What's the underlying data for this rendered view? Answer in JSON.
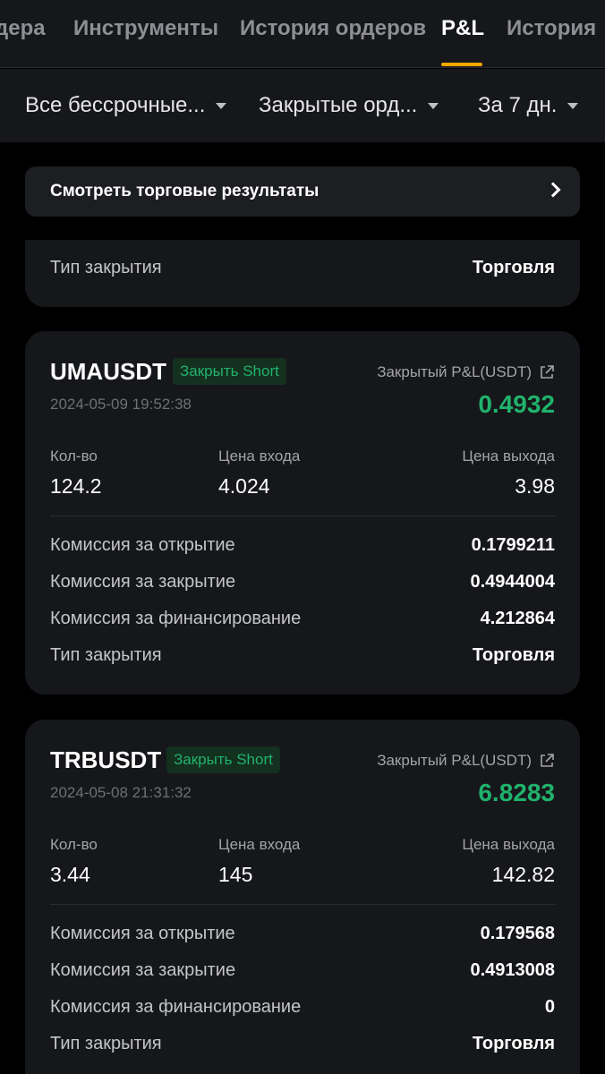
{
  "tabs": [
    {
      "label": "дера"
    },
    {
      "label": "Инструменты"
    },
    {
      "label": "История ордеров"
    },
    {
      "label": "P&L"
    },
    {
      "label": "История"
    }
  ],
  "filters": [
    {
      "label": "Все бессрочные..."
    },
    {
      "label": "Закрытые орд..."
    },
    {
      "label": "За 7 дн."
    }
  ],
  "banner": {
    "label": "Смотреть торговые результаты"
  },
  "partial_card": {
    "close_type_label": "Тип закрытия",
    "close_type_value": "Торговля"
  },
  "orders": [
    {
      "symbol": "UMAUSDT",
      "badge": "Закрыть Short",
      "timestamp": "2024-05-09 19:52:38",
      "pnl_label": "Закрытый P&L(USDT)",
      "pnl_value": "0.4932",
      "qty_label": "Кол-во",
      "qty": "124.2",
      "entry_label": "Цена входа",
      "entry": "4.024",
      "exit_label": "Цена выхода",
      "exit": "3.98",
      "open_fee_label": "Комиссия за открытие",
      "open_fee": "0.1799211",
      "close_fee_label": "Комиссия за закрытие",
      "close_fee": "0.4944004",
      "funding_fee_label": "Комиссия за финансирование",
      "funding_fee": "4.212864",
      "close_type_label": "Тип закрытия",
      "close_type": "Торговля"
    },
    {
      "symbol": "TRBUSDT",
      "badge": "Закрыть Short",
      "timestamp": "2024-05-08 21:31:32",
      "pnl_label": "Закрытый P&L(USDT)",
      "pnl_value": "6.8283",
      "qty_label": "Кол-во",
      "qty": "3.44",
      "entry_label": "Цена входа",
      "entry": "145",
      "exit_label": "Цена выхода",
      "exit": "142.82",
      "open_fee_label": "Комиссия за открытие",
      "open_fee": "0.179568",
      "close_fee_label": "Комиссия за закрытие",
      "close_fee": "0.4913008",
      "funding_fee_label": "Комиссия за финансирование",
      "funding_fee": "0",
      "close_type_label": "Тип закрытия",
      "close_type": "Торговля"
    }
  ],
  "colors": {
    "accent": "#f7a600",
    "profit": "#20b26c",
    "background": "#000000",
    "card": "#16171a"
  }
}
